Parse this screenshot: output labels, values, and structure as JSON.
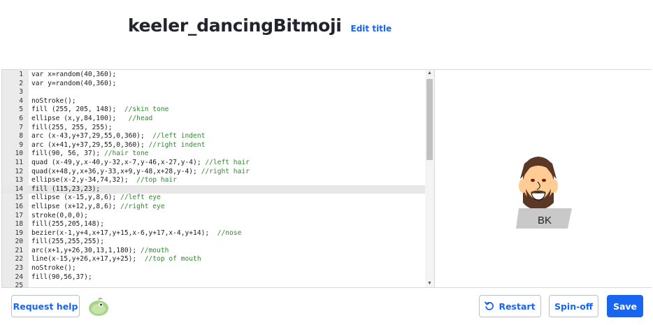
{
  "header": {
    "title": "keeler_dancingBitmoji",
    "edit_title_label": "Edit title"
  },
  "editor": {
    "active_line": 14,
    "lines": [
      {
        "code": "var x=random(40,360);",
        "comment": ""
      },
      {
        "code": "var y=random(40,360);",
        "comment": ""
      },
      {
        "code": "",
        "comment": ""
      },
      {
        "code": "noStroke();",
        "comment": ""
      },
      {
        "code": "fill (255, 205, 148);  ",
        "comment": "//skin tone"
      },
      {
        "code": "ellipse (x,y,84,100);   ",
        "comment": "//head"
      },
      {
        "code": "fill(255, 255, 255);",
        "comment": ""
      },
      {
        "code": "arc (x-43,y+37,29,55,0,360);  ",
        "comment": "//left indent"
      },
      {
        "code": "arc (x+41,y+37,29,55,0,360); ",
        "comment": "//right indent"
      },
      {
        "code": "fill(90, 56, 37); ",
        "comment": "//hair tone"
      },
      {
        "code": "quad (x-49,y,x-40,y-32,x-7,y-46,x-27,y-4); ",
        "comment": "//left hair"
      },
      {
        "code": "quad(x+48,y,x+36,y-33,x+9,y-48,x+28,y-4); ",
        "comment": "//right hair"
      },
      {
        "code": "ellipse(x-2,y-34,74,32);  ",
        "comment": "//top hair"
      },
      {
        "code": "fill (115,23,23);",
        "comment": ""
      },
      {
        "code": "ellipse (x-15,y,8,6); ",
        "comment": "//left eye"
      },
      {
        "code": "ellipse (x+12,y,8,6); ",
        "comment": "//right eye"
      },
      {
        "code": "stroke(0,0,0);",
        "comment": ""
      },
      {
        "code": "fill(255,205,148);",
        "comment": ""
      },
      {
        "code": "bezier(x-1,y+4,x+17,y+15,x-6,y+17,x-4,y+14);  ",
        "comment": "//nose"
      },
      {
        "code": "fill(255,255,255);",
        "comment": ""
      },
      {
        "code": "arc(x+1,y+26,30,13,1,180); ",
        "comment": "//mouth"
      },
      {
        "code": "line(x-15,y+26,x+17,y+25);  ",
        "comment": "//top of mouth"
      },
      {
        "code": "noStroke();",
        "comment": ""
      },
      {
        "code": "fill(90,56,37);",
        "comment": ""
      },
      {
        "code": "",
        "comment": ""
      }
    ]
  },
  "canvas": {
    "sign_text": "BK"
  },
  "footer": {
    "request_help_label": "Request help",
    "restart_label": "Restart",
    "spinoff_label": "Spin-off",
    "save_label": "Save"
  },
  "colors": {
    "accent": "#1865f2",
    "skin": "#ffcd94",
    "hair": "#5a3825",
    "comment": "#2f8a2f"
  },
  "icons": [
    "restart-icon",
    "scroll-up-icon",
    "scroll-down-icon",
    "user-avatar-icon"
  ]
}
